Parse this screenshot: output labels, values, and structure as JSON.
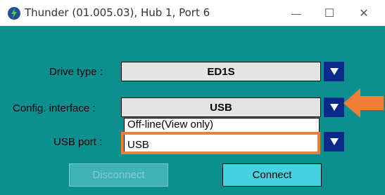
{
  "window": {
    "title": "Thunder (01.005.03), Hub 1, Port 6",
    "minimize_glyph": "—",
    "maximize_glyph": "☐",
    "close_glyph": "✕"
  },
  "form": {
    "drive_type": {
      "label": "Drive type :",
      "value": "ED1S"
    },
    "config_interface": {
      "label": "Config. interface :",
      "value": "USB"
    },
    "usb_port": {
      "label": "USB port :"
    },
    "dropdown_options": [
      "Off-line(View only)",
      "USB"
    ]
  },
  "buttons": {
    "disconnect": "Disconnect",
    "connect": "Connect"
  },
  "colors": {
    "client_bg": "#0e8f8f",
    "accent_orange": "#f07f35",
    "dropdown_button": "#0a2a8a"
  },
  "icons": [
    "thunder-app-icon",
    "dropdown-arrow-icon",
    "callout-arrow-icon"
  ]
}
